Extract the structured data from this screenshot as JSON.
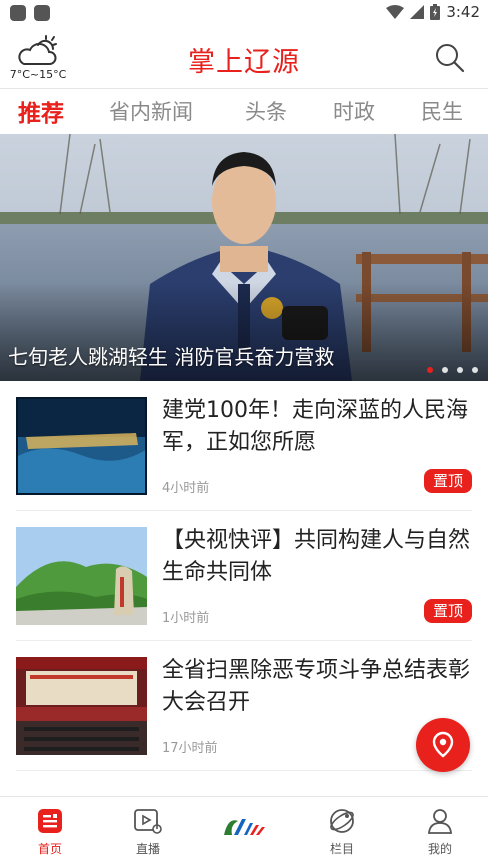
{
  "status_bar": {
    "time": "3:42"
  },
  "header": {
    "weather_temp": "7°C~15°C",
    "title": "掌上辽源"
  },
  "tabs": [
    {
      "label": "推荐",
      "active": true
    },
    {
      "label": "省内新闻",
      "active": false
    },
    {
      "label": "头条",
      "active": false
    },
    {
      "label": "时政",
      "active": false
    },
    {
      "label": "民生",
      "active": false
    }
  ],
  "banner": {
    "caption": "七旬老人跳湖轻生  消防官兵奋力营救",
    "slide_count": 4,
    "active_slide": 1
  },
  "news": [
    {
      "title": "建党100年！走向深蓝的人民海军，正如您所愿",
      "time": "4小时前",
      "badge": "置顶"
    },
    {
      "title": "【央视快评】共同构建人与自然生命共同体",
      "time": "1小时前",
      "badge": "置顶"
    },
    {
      "title": "全省扫黑除恶专项斗争总结表彰大会召开",
      "time": "17小时前",
      "badge": ""
    }
  ],
  "bottom_nav": [
    {
      "label": "首页",
      "icon": "news-icon",
      "active": true
    },
    {
      "label": "直播",
      "icon": "live-icon",
      "active": false
    },
    {
      "label": "",
      "icon": "brand-logo",
      "active": false
    },
    {
      "label": "栏目",
      "icon": "planet-icon",
      "active": false
    },
    {
      "label": "我的",
      "icon": "user-icon",
      "active": false
    }
  ],
  "colors": {
    "accent": "#e8211d",
    "inactive_text": "#8a8a8a"
  }
}
